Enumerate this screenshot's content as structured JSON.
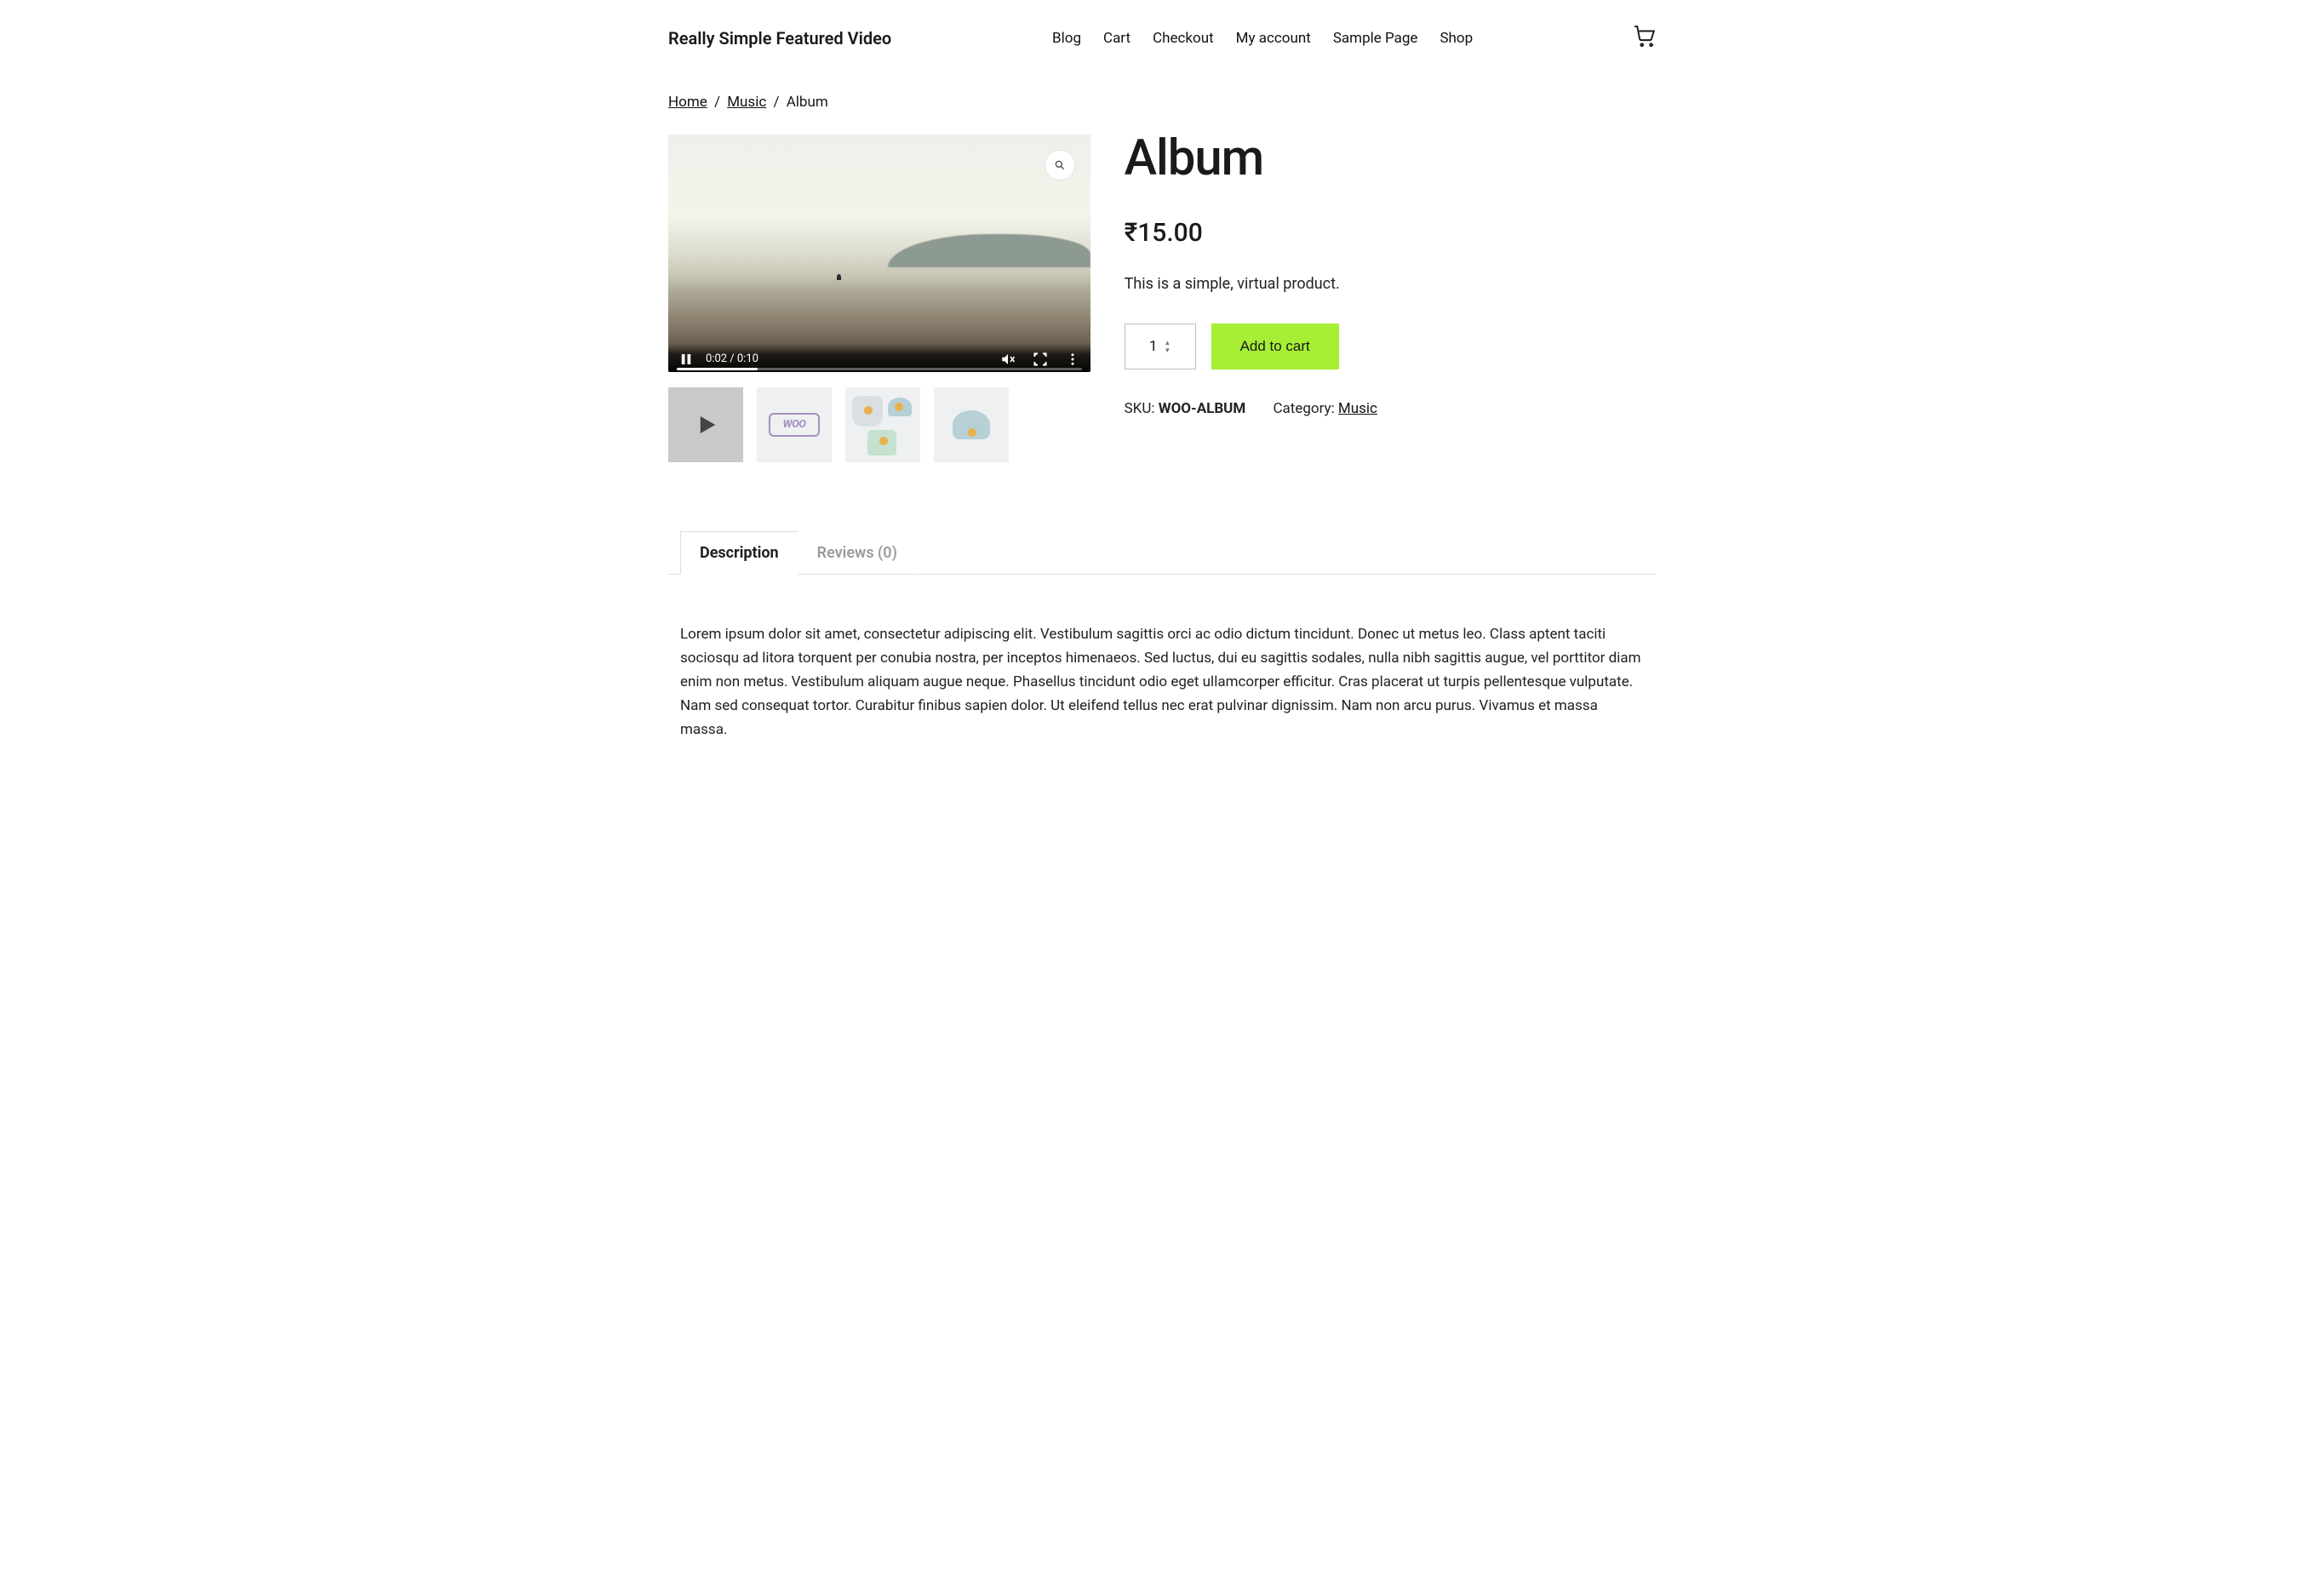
{
  "site": {
    "title": "Really Simple Featured Video"
  },
  "nav": {
    "items": [
      {
        "label": "Blog"
      },
      {
        "label": "Cart"
      },
      {
        "label": "Checkout"
      },
      {
        "label": "My account"
      },
      {
        "label": "Sample Page"
      },
      {
        "label": "Shop"
      }
    ]
  },
  "breadcrumb": {
    "home": "Home",
    "category": "Music",
    "current": "Album",
    "sep": "/"
  },
  "video": {
    "time": "0:02 / 0:10"
  },
  "product": {
    "title": "Album",
    "currency": "₹",
    "price": "15.00",
    "short_description": "This is a simple, virtual product.",
    "quantity": "1",
    "add_to_cart_label": "Add to cart",
    "sku_label": "SKU:",
    "sku": "WOO-ALBUM",
    "category_label": "Category:",
    "category": "Music"
  },
  "thumbs": {
    "woo_label": "WOO"
  },
  "tabs": {
    "description_label": "Description",
    "reviews_label": "Reviews (0)"
  },
  "description": {
    "body": "Lorem ipsum dolor sit amet, consectetur adipiscing elit. Vestibulum sagittis orci ac odio dictum tincidunt. Donec ut metus leo. Class aptent taciti sociosqu ad litora torquent per conubia nostra, per inceptos himenaeos. Sed luctus, dui eu sagittis sodales, nulla nibh sagittis augue, vel porttitor diam enim non metus. Vestibulum aliquam augue neque. Phasellus tincidunt odio eget ullamcorper efficitur. Cras placerat ut turpis pellentesque vulputate. Nam sed consequat tortor. Curabitur finibus sapien dolor. Ut eleifend tellus nec erat pulvinar dignissim. Nam non arcu purus. Vivamus et massa massa."
  }
}
